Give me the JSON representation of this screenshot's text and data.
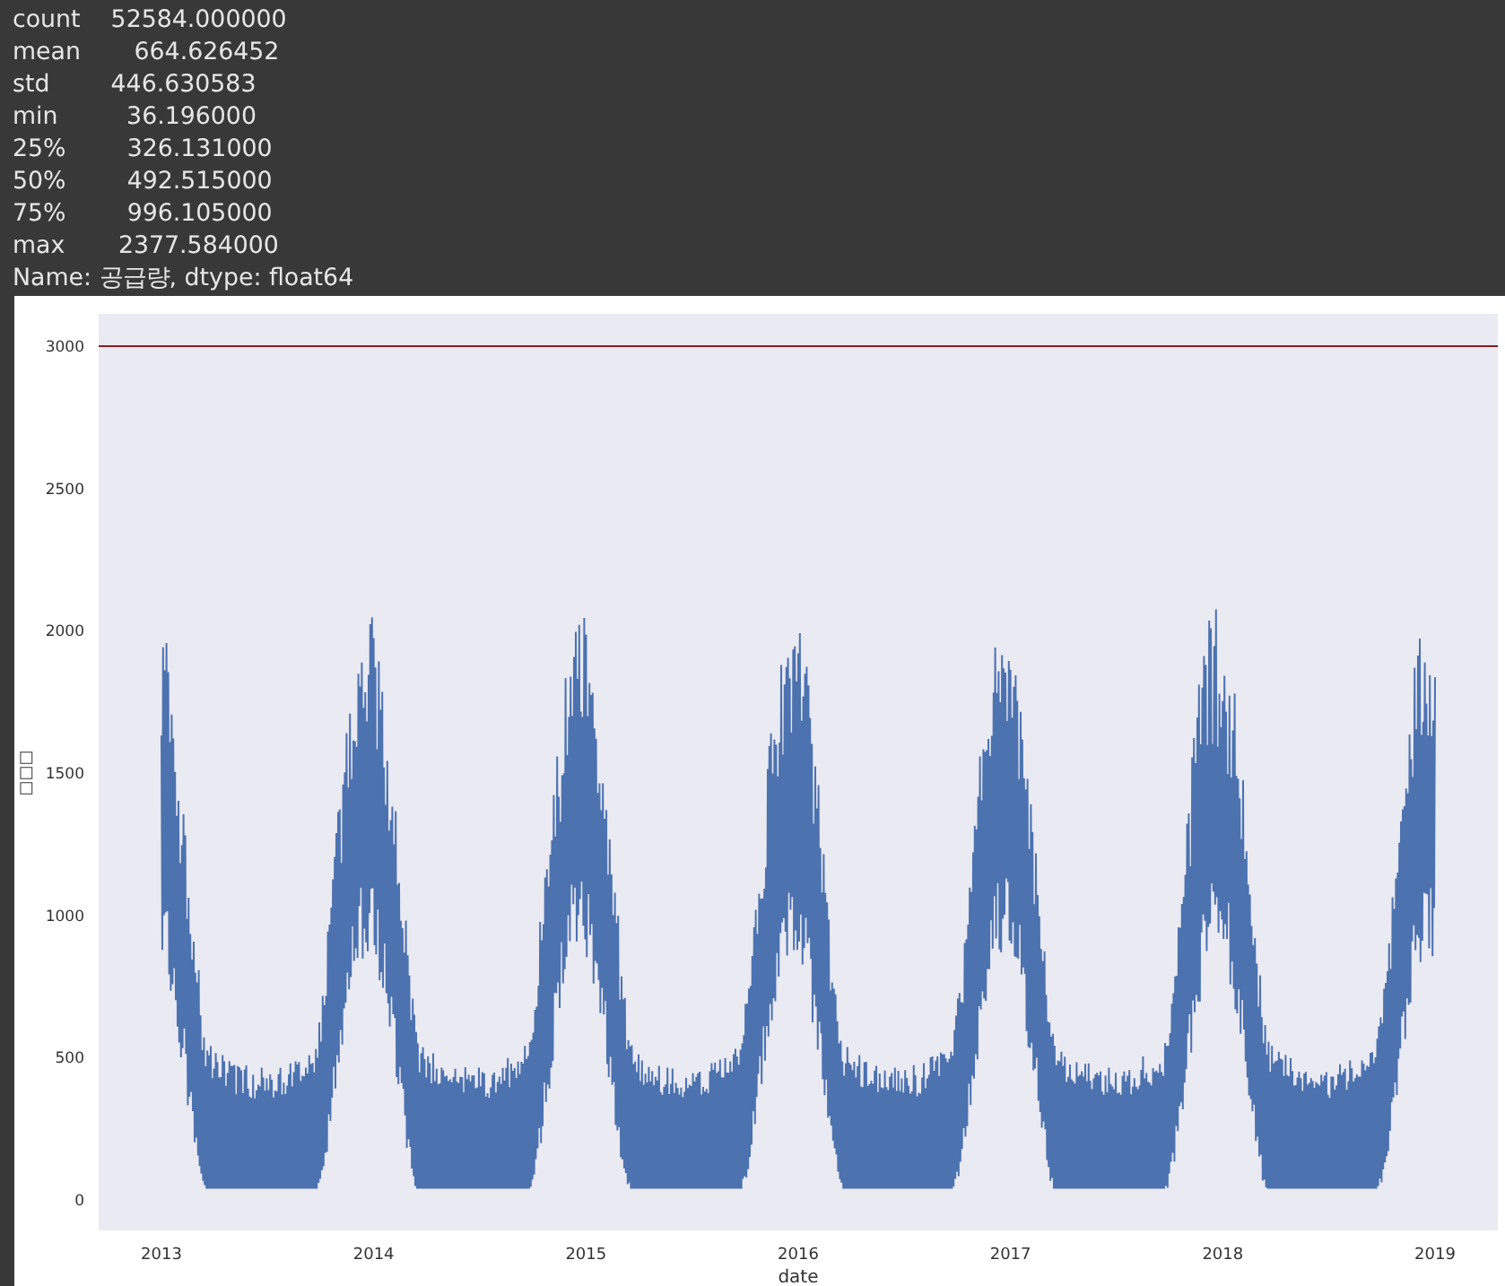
{
  "output_lines": [
    "count    52584.000000",
    "mean       664.626452",
    "std        446.630583",
    "min         36.196000",
    "25%        326.131000",
    "50%        492.515000",
    "75%        996.105000",
    "max       2377.584000",
    "Name: 공급량, dtype: float64"
  ],
  "plot": {
    "ylabel": "□□□",
    "xlabel": "date",
    "yticks": [
      "3000",
      "2500",
      "2000",
      "1500",
      "1000",
      "500",
      "0"
    ],
    "xticks": [
      "2013",
      "2014",
      "2015",
      "2016",
      "2017",
      "2018",
      "2019"
    ]
  }
}
